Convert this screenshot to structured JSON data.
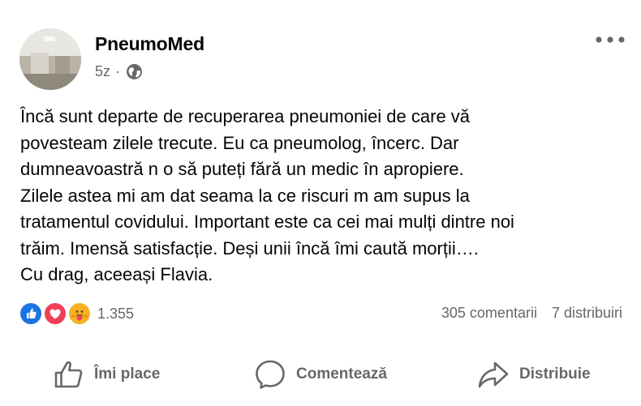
{
  "post": {
    "author": "PneumoMed",
    "time": "5z",
    "separator": "·",
    "privacy_icon": "globe-icon",
    "more_icon": "more-options-icon",
    "text_lines": [
      "Încă sunt departe de recuperarea pneumoniei de care vă",
      "povesteam zilele trecute. Eu ca pneumolog, încerc. Dar",
      "dumneavoastră n o să puteți fără un medic în apropiere.",
      "Zilele astea mi am dat seama la ce riscuri m am supus la",
      "tratamentul covidului. Important este ca cei mai mulți dintre noi",
      "trăim. Imensă satisfacție. Deși unii încă îmi caută morții….",
      "Cu drag, aceeași Flavia."
    ]
  },
  "reactions": {
    "icons": [
      "like-reaction-icon",
      "love-reaction-icon",
      "care-reaction-icon"
    ],
    "count": "1.355",
    "comments": "305 comentarii",
    "shares": "7 distribuiri"
  },
  "actions": {
    "like_label": "Îmi place",
    "comment_label": "Comentează",
    "share_label": "Distribuie"
  },
  "colors": {
    "text": "#050505",
    "secondary": "#65676b",
    "like_blue": "#1b74e4",
    "love_red": "#f33e58",
    "care_yellow": "#f7b125"
  }
}
